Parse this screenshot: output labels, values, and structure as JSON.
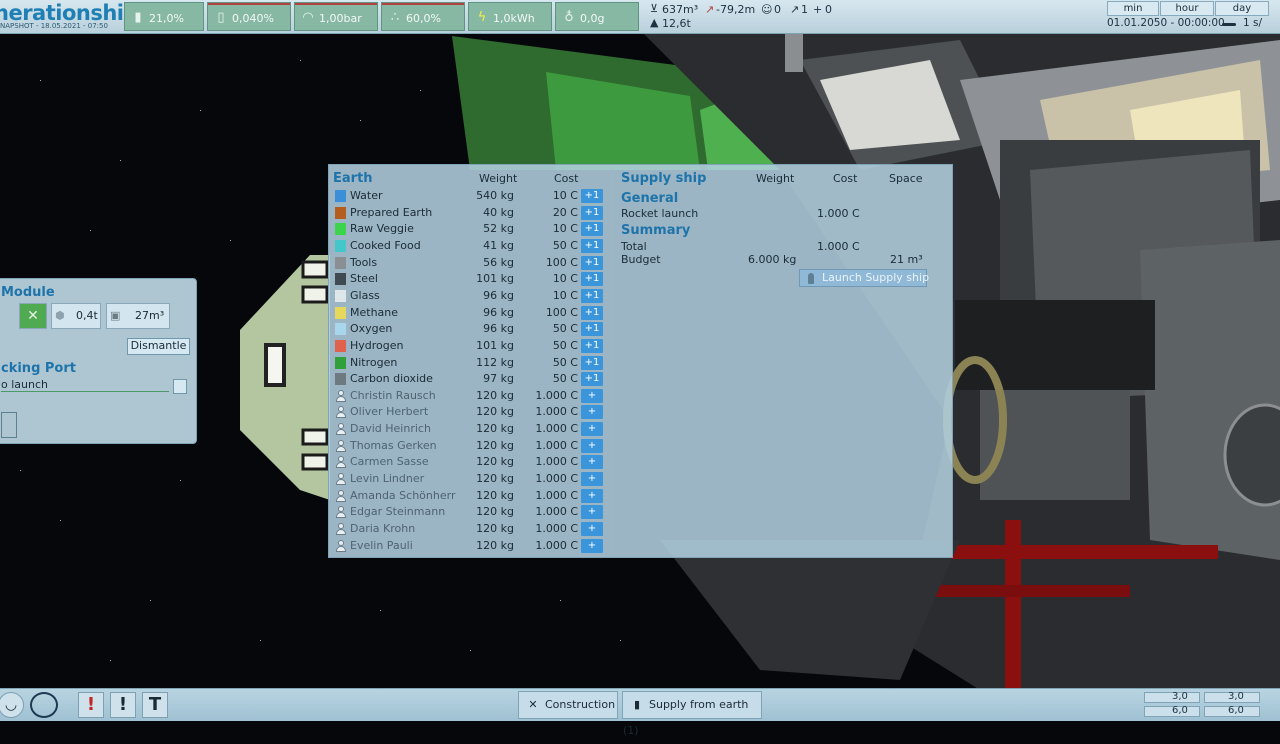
{
  "top_bar": {
    "logo_title": "nerationship",
    "logo_subtitle": "NAPSHOT - 18.05.2021 - 07:50",
    "stats": [
      {
        "icon": "thermometer-icon",
        "value": "21,0%"
      },
      {
        "icon": "percent-icon",
        "value": "0,040%"
      },
      {
        "icon": "gauge-icon",
        "value": "1,00bar"
      },
      {
        "icon": "humidity-icon",
        "value": "60,0%"
      },
      {
        "icon": "lightning-icon",
        "value": "1,0kWh"
      },
      {
        "icon": "gravity-icon",
        "value": "0,0g"
      }
    ],
    "volume": "637m³",
    "altitude": "-79,2m",
    "mass": "12,6t",
    "crew_count": "0",
    "probe_count": "1",
    "dock_count": "0",
    "time_buttons": [
      "min",
      "hour",
      "day"
    ],
    "date": "01.01.2050 - 00:00:00",
    "speed": "1 s/"
  },
  "module_panel": {
    "title": "Module",
    "mass": "0,4t",
    "volume": "27m³",
    "dismantle_label": "Dismantle",
    "port_title": "cking Port",
    "port_status": "o launch"
  },
  "earth_panel": {
    "title": "Earth",
    "col_weight": "Weight",
    "col_cost": "Cost",
    "items": [
      {
        "name": "Water",
        "weight": "540 kg",
        "cost": "10 C",
        "add": "+1",
        "color": "#3b8fd8",
        "person": false
      },
      {
        "name": "Prepared Earth",
        "weight": "40 kg",
        "cost": "20 C",
        "add": "+1",
        "color": "#b35d1e",
        "person": false
      },
      {
        "name": "Raw Veggie",
        "weight": "52 kg",
        "cost": "10 C",
        "add": "+1",
        "color": "#3cd44c",
        "person": false
      },
      {
        "name": "Cooked Food",
        "weight": "41 kg",
        "cost": "50 C",
        "add": "+1",
        "color": "#45c6c9",
        "person": false
      },
      {
        "name": "Tools",
        "weight": "56 kg",
        "cost": "100 C",
        "add": "+1",
        "color": "#8a8f93",
        "person": false
      },
      {
        "name": "Steel",
        "weight": "101 kg",
        "cost": "10 C",
        "add": "+1",
        "color": "#3f4a52",
        "person": false
      },
      {
        "name": "Glass",
        "weight": "96 kg",
        "cost": "10 C",
        "add": "+1",
        "color": "#dfe6ea",
        "person": false
      },
      {
        "name": "Methane",
        "weight": "96 kg",
        "cost": "100 C",
        "add": "+1",
        "color": "#e6d85a",
        "person": false
      },
      {
        "name": "Oxygen",
        "weight": "96 kg",
        "cost": "50 C",
        "add": "+1",
        "color": "#a8d6ec",
        "person": false
      },
      {
        "name": "Hydrogen",
        "weight": "101 kg",
        "cost": "50 C",
        "add": "+1",
        "color": "#e0614c",
        "person": false
      },
      {
        "name": "Nitrogen",
        "weight": "112 kg",
        "cost": "50 C",
        "add": "+1",
        "color": "#2fa03a",
        "person": false
      },
      {
        "name": "Carbon dioxide",
        "weight": "97 kg",
        "cost": "50 C",
        "add": "+1",
        "color": "#6f7a80",
        "person": false
      },
      {
        "name": "Christin Rausch",
        "weight": "120 kg",
        "cost": "1.000 C",
        "add": "+",
        "person": true
      },
      {
        "name": "Oliver Herbert",
        "weight": "120 kg",
        "cost": "1.000 C",
        "add": "+",
        "person": true
      },
      {
        "name": "David Heinrich",
        "weight": "120 kg",
        "cost": "1.000 C",
        "add": "+",
        "person": true
      },
      {
        "name": "Thomas Gerken",
        "weight": "120 kg",
        "cost": "1.000 C",
        "add": "+",
        "person": true
      },
      {
        "name": "Carmen Sasse",
        "weight": "120 kg",
        "cost": "1.000 C",
        "add": "+",
        "person": true
      },
      {
        "name": "Levin Lindner",
        "weight": "120 kg",
        "cost": "1.000 C",
        "add": "+",
        "person": true
      },
      {
        "name": "Amanda Schönherr",
        "weight": "120 kg",
        "cost": "1.000 C",
        "add": "+",
        "person": true
      },
      {
        "name": "Edgar Steinmann",
        "weight": "120 kg",
        "cost": "1.000 C",
        "add": "+",
        "person": true
      },
      {
        "name": "Daria Krohn",
        "weight": "120 kg",
        "cost": "1.000 C",
        "add": "+",
        "person": true
      },
      {
        "name": "Evelin Pauli",
        "weight": "120 kg",
        "cost": "1.000 C",
        "add": "+",
        "person": true
      }
    ]
  },
  "supply_ship": {
    "title": "Supply ship",
    "col_weight": "Weight",
    "col_cost": "Cost",
    "col_space": "Space",
    "general_title": "General",
    "rocket_label": "Rocket launch",
    "rocket_cost": "1.000 C",
    "summary_title": "Summary",
    "total_label": "Total",
    "total_cost": "1.000 C",
    "budget_label": "Budget",
    "budget_weight": "6.000 kg",
    "budget_space": "21 m³",
    "launch_label": "Launch Supply ship"
  },
  "bottom_bar": {
    "construction_label": "Construction",
    "supply_label": "Supply from earth (1)",
    "res_a1": "3,0",
    "res_a2": "6,0",
    "res_b1": "3,0",
    "res_b2": "6,0"
  }
}
